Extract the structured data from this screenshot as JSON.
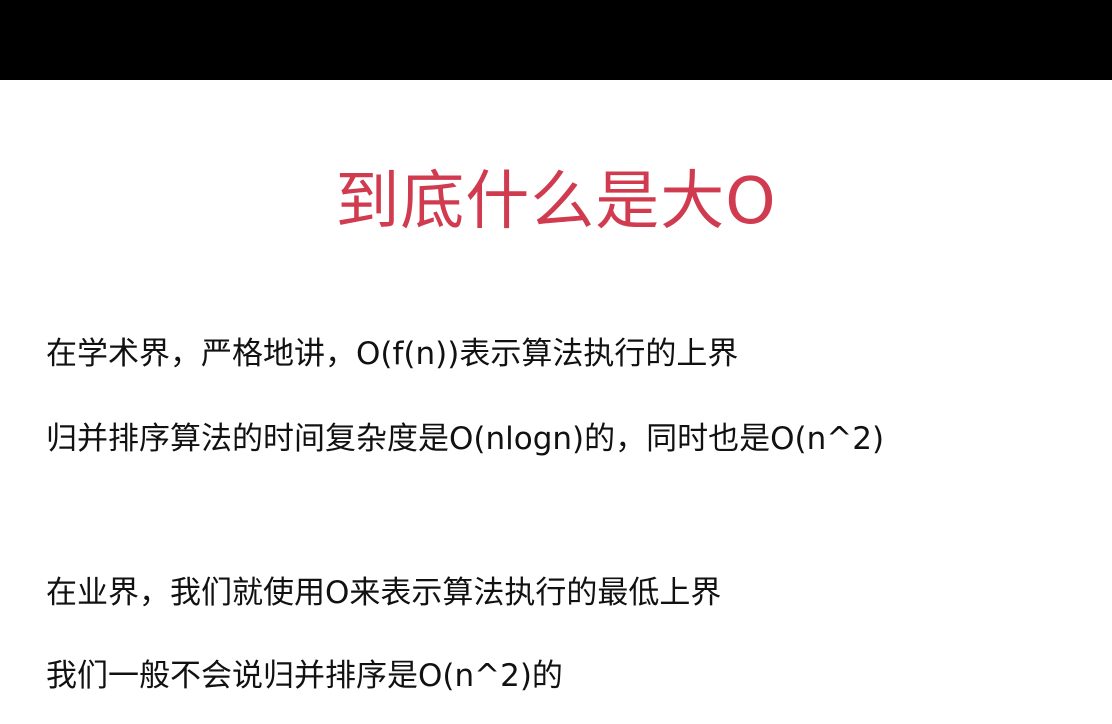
{
  "slide": {
    "title": "到底什么是大O",
    "lines": [
      "在学术界，严格地讲，O(f(n))表示算法执行的上界",
      "归并排序算法的时间复杂度是O(nlogn)的，同时也是O(n^2)",
      "在业界，我们就使用O来表示算法执行的最低上界",
      "我们一般不会说归并排序是O(n^2)的"
    ]
  },
  "colors": {
    "title": "#d13b4f",
    "text": "#111111",
    "top_bar": "#000000",
    "background": "#ffffff"
  }
}
